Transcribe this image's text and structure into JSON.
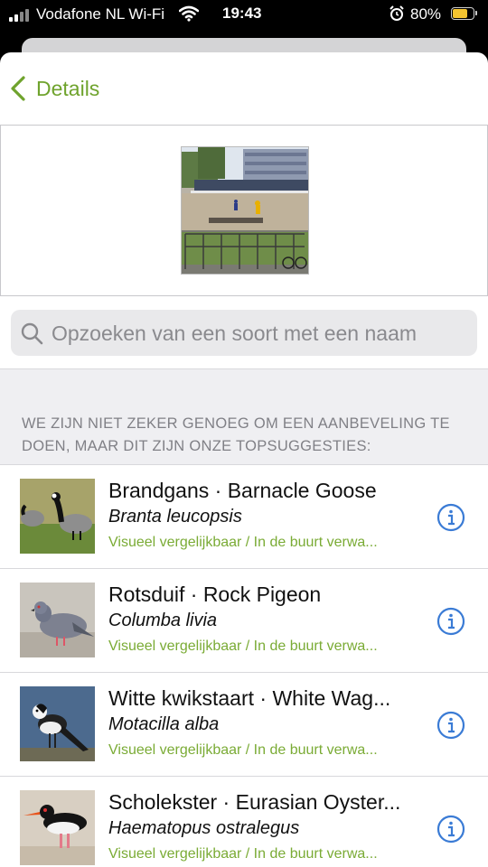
{
  "status_bar": {
    "carrier": "Vodafone NL Wi-Fi",
    "time": "19:43",
    "battery_percent": "80%",
    "battery_level": 0.8,
    "icons": [
      "signal-icon",
      "wifi-icon",
      "alarm-icon",
      "battery-icon"
    ]
  },
  "nav": {
    "back_label": "Details",
    "accent_color": "#6fa32d"
  },
  "search": {
    "placeholder": "Opzoeken van een soort met een naam"
  },
  "suggestions": {
    "header": "WE ZIJN NIET ZEKER GENOEG OM EEN AANBEVELING TE DOEN, MAAR DIT ZIJN ONZE TOPSUGGESTIES:",
    "items": [
      {
        "common_name": "Brandgans · Barnacle Goose",
        "scientific_name": "Branta leucopsis",
        "reason": "Visueel vergelijkbaar / In de buurt verwa..."
      },
      {
        "common_name": "Rotsduif · Rock Pigeon",
        "scientific_name": "Columba livia",
        "reason": "Visueel vergelijkbaar / In de buurt verwa..."
      },
      {
        "common_name": "Witte kwikstaart · White Wag...",
        "scientific_name": "Motacilla alba",
        "reason": "Visueel vergelijkbaar / In de buurt verwa..."
      },
      {
        "common_name": "Scholekster · Eurasian Oyster...",
        "scientific_name": "Haematopus ostralegus",
        "reason": "Visueel vergelijkbaar / In de buurt verwa..."
      }
    ]
  }
}
